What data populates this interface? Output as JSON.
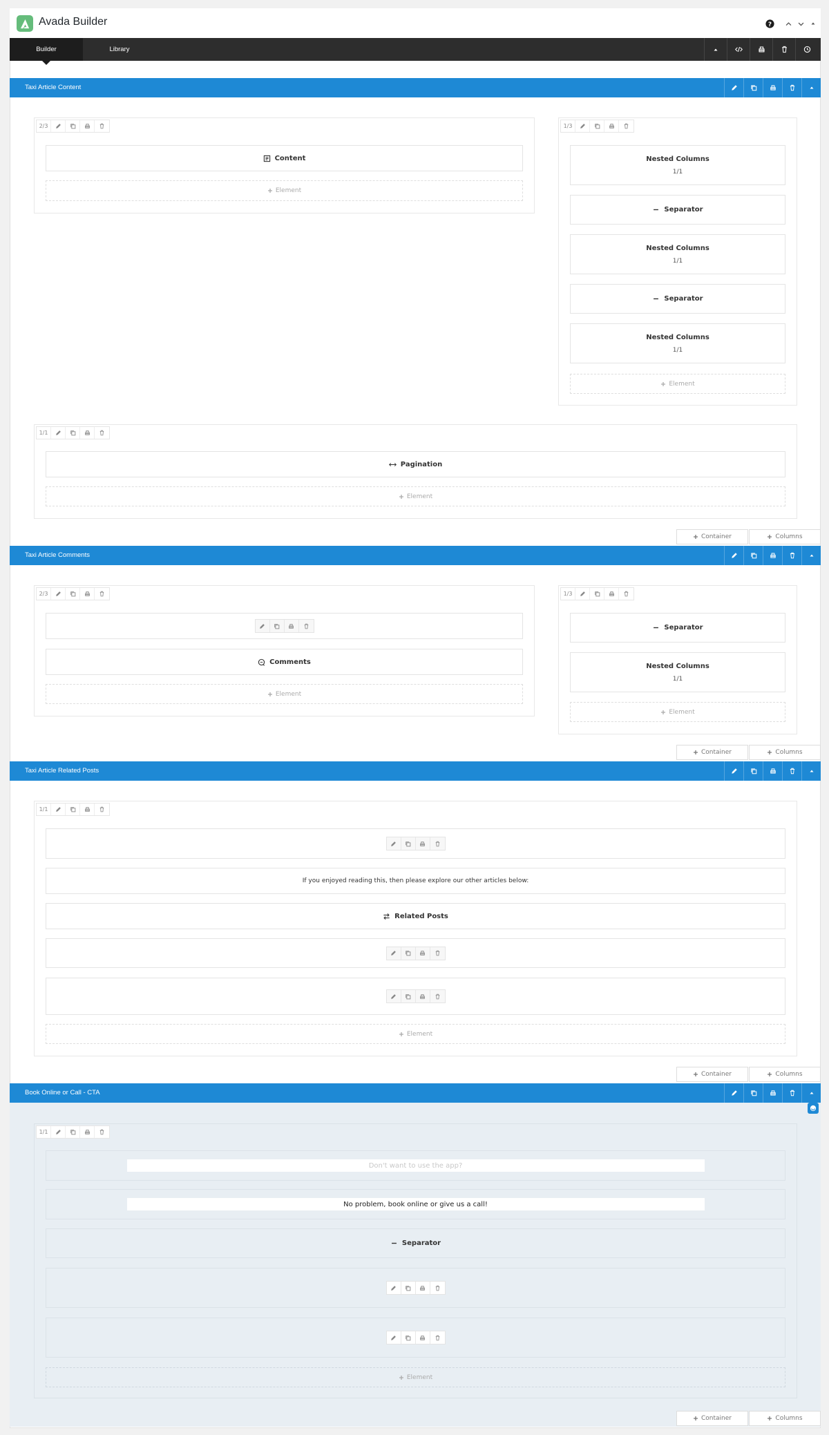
{
  "app": {
    "title": "Avada Builder"
  },
  "nav": {
    "tabs": [
      {
        "label": "Builder",
        "active": true
      },
      {
        "label": "Library",
        "active": false
      }
    ]
  },
  "colors": {
    "accent": "#1e89d5",
    "logo": "#65bc7b",
    "navbar": "#2d2d2d",
    "cta_background": "#e8eef3"
  },
  "common": {
    "add_element": "Element",
    "add_container": "Container",
    "add_columns": "Columns"
  },
  "containers": [
    {
      "title": "Taxi Article Content",
      "columns": [
        {
          "size": "2/3",
          "elements": [
            {
              "label": "Content",
              "icon": "content-icon"
            }
          ]
        },
        {
          "size": "1/3",
          "elements": [
            {
              "label": "Nested Columns",
              "sub": "1/1"
            },
            {
              "label": "Separator",
              "icon": "separator-icon"
            },
            {
              "label": "Nested Columns",
              "sub": "1/1"
            },
            {
              "label": "Separator",
              "icon": "separator-icon"
            },
            {
              "label": "Nested Columns",
              "sub": "1/1"
            }
          ]
        },
        {
          "size": "1/1",
          "elements": [
            {
              "label": "Pagination",
              "icon": "pagination-icon"
            }
          ]
        }
      ]
    },
    {
      "title": "Taxi Article Comments",
      "columns": [
        {
          "size": "2/3",
          "elements": [
            {
              "label": "",
              "type": "toolbar-only"
            },
            {
              "label": "Comments",
              "icon": "comments-icon"
            }
          ]
        },
        {
          "size": "1/3",
          "elements": [
            {
              "label": "Separator",
              "icon": "separator-icon"
            },
            {
              "label": "Nested Columns",
              "sub": "1/1"
            }
          ]
        }
      ]
    },
    {
      "title": "Taxi Article Related Posts",
      "columns": [
        {
          "size": "1/1",
          "elements": [
            {
              "label": "",
              "type": "toolbar-only"
            },
            {
              "label": "If you enjoyed reading this, then please explore our other articles below:",
              "type": "text"
            },
            {
              "label": "Related Posts",
              "icon": "related-posts-icon"
            },
            {
              "label": "",
              "type": "toolbar-only"
            },
            {
              "label": "",
              "type": "toolbar-only"
            }
          ]
        }
      ]
    },
    {
      "title": "Book Online or Call - CTA",
      "columns": [
        {
          "size": "1/1",
          "elements": [
            {
              "label": "Don't want to use the app?",
              "type": "faded-text"
            },
            {
              "label": "No problem, book online or give us a call!",
              "type": "text"
            },
            {
              "label": "Separator",
              "icon": "separator-icon"
            },
            {
              "label": "",
              "type": "toolbar-only"
            },
            {
              "label": "",
              "type": "toolbar-only"
            }
          ]
        }
      ]
    }
  ]
}
